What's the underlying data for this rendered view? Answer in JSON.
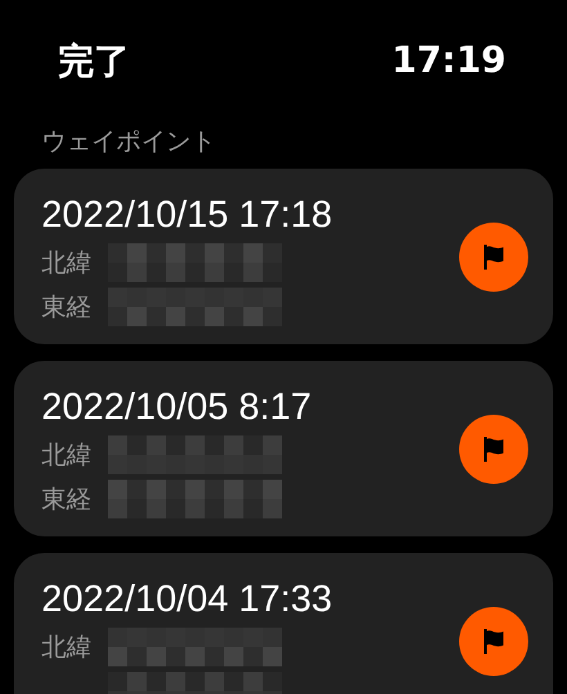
{
  "header": {
    "done_button": "完了",
    "time": "17:19"
  },
  "section_title": "ウェイポイント",
  "waypoints": [
    {
      "date": "2022/10/15 17:18",
      "latitude_label": "北緯",
      "longitude_label": "東経"
    },
    {
      "date": "2022/10/05 8:17",
      "latitude_label": "北緯",
      "longitude_label": "東経"
    },
    {
      "date": "2022/10/04 17:33",
      "latitude_label": "北緯"
    }
  ]
}
